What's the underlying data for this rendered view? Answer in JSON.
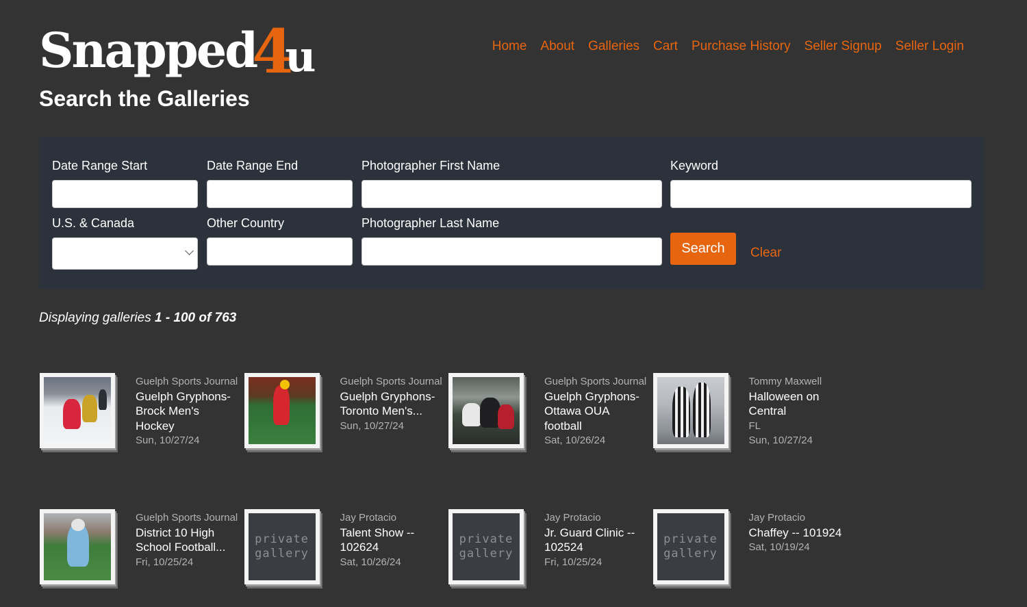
{
  "brand": {
    "logo_word": "Snapped",
    "logo_four": "4",
    "logo_u": "u",
    "accent": "#e8650f",
    "background": "#333333",
    "panel": "#2c323b"
  },
  "nav": [
    "Home",
    "About",
    "Galleries",
    "Cart",
    "Purchase History",
    "Seller Signup",
    "Seller Login"
  ],
  "page_title": "Search the Galleries",
  "search": {
    "date_start_label": "Date Range Start",
    "date_start_value": "",
    "date_end_label": "Date Range End",
    "date_end_value": "",
    "first_name_label": "Photographer First Name",
    "first_name_value": "",
    "keyword_label": "Keyword",
    "keyword_value": "",
    "region_label": "U.S. & Canada",
    "region_value": "",
    "country_label": "Other Country",
    "country_value": "",
    "last_name_label": "Photographer Last Name",
    "last_name_value": "",
    "search_button": "Search",
    "clear_link": "Clear"
  },
  "results": {
    "prefix": "Displaying galleries ",
    "range": "1 - 100",
    "of": " of ",
    "total": "763"
  },
  "galleries": [
    {
      "owner": "Guelph Sports Journal",
      "title": "Guelph Gryphons- Brock Men's Hockey",
      "location": "",
      "date": "Sun, 10/27/24",
      "thumb": "photo-hockey",
      "private": false
    },
    {
      "owner": "Guelph Sports Journal",
      "title": "Guelph Gryphons- Toronto Men's...",
      "location": "",
      "date": "Sun, 10/27/24",
      "thumb": "photo-lacrosse",
      "private": false
    },
    {
      "owner": "Guelph Sports Journal",
      "title": "Guelph Gryphons- Ottawa OUA football",
      "location": "",
      "date": "Sat, 10/26/24",
      "thumb": "photo-football",
      "private": false
    },
    {
      "owner": "Tommy Maxwell",
      "title": "Halloween on Central",
      "location": "FL",
      "date": "Sun, 10/27/24",
      "thumb": "photo-halloween",
      "private": false
    },
    {
      "owner": "Guelph Sports Journal",
      "title": "District 10 High School Football...",
      "location": "",
      "date": "Fri, 10/25/24",
      "thumb": "photo-highschool",
      "private": false
    },
    {
      "owner": "Jay Protacio",
      "title": "Talent Show -- 102624",
      "location": "",
      "date": "Sat, 10/26/24",
      "thumb": "private-gallery",
      "private": true
    },
    {
      "owner": "Jay Protacio",
      "title": "Jr. Guard Clinic -- 102524",
      "location": "",
      "date": "Fri, 10/25/24",
      "thumb": "private-gallery",
      "private": true
    },
    {
      "owner": "Jay Protacio",
      "title": "Chaffey -- 101924",
      "location": "",
      "date": "Sat, 10/19/24",
      "thumb": "private-gallery",
      "private": true
    }
  ],
  "private_label_1": "private",
  "private_label_2": "gallery"
}
